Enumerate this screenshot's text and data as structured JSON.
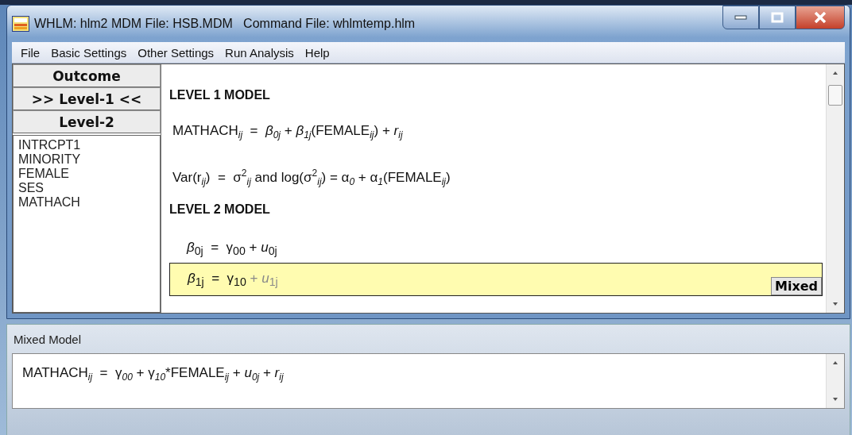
{
  "window": {
    "title": "WHLM: hlm2 MDM File: HSB.MDM   Command File: whlmtemp.hlm"
  },
  "menu": [
    "File",
    "Basic Settings",
    "Other Settings",
    "Run Analysis",
    "Help"
  ],
  "level_buttons": [
    "Outcome",
    ">> Level-1 <<",
    "Level-2"
  ],
  "variables": [
    "INTRCPT1",
    "MINORITY",
    "FEMALE",
    "SES",
    "MATHACH"
  ],
  "level1": {
    "heading": "LEVEL 1 MODEL",
    "equations": [
      "MATHACH$_{ij}$  =  *β*$_{0j}$ + *β*$_{1j}$(FEMALE$_{ij}$) + *r*$_{ij}$",
      "Var(r$_{ij}$)  =  σ$^{2}$$_{ij}$ and log(σ$^{2}$$_{ij}$) = α$_{0}$ + α$_{1}$(FEMALE$_{ij}$)"
    ]
  },
  "level2": {
    "heading": "LEVEL 2 MODEL",
    "equations": [
      {
        "text": "*β*$_{0j}$  =  γ$_{00}$",
        "random_term": " + *u*$_{0j}$",
        "random_enabled": true,
        "selected": false
      },
      {
        "text": "*β*$_{1j}$  =  γ$_{10}$",
        "random_term": " + *u*$_{1j}$",
        "random_enabled": false,
        "selected": true
      }
    ],
    "mixed_button": "Mixed"
  },
  "mixed_model": {
    "label": "Mixed Model",
    "equation": "MATHACH$_{ij}$  =  γ$_{00}$ + γ$_{10}$*FEMALE$_{ij}$ + *u*$_{0j}$ + *r*$_{ij}$"
  }
}
